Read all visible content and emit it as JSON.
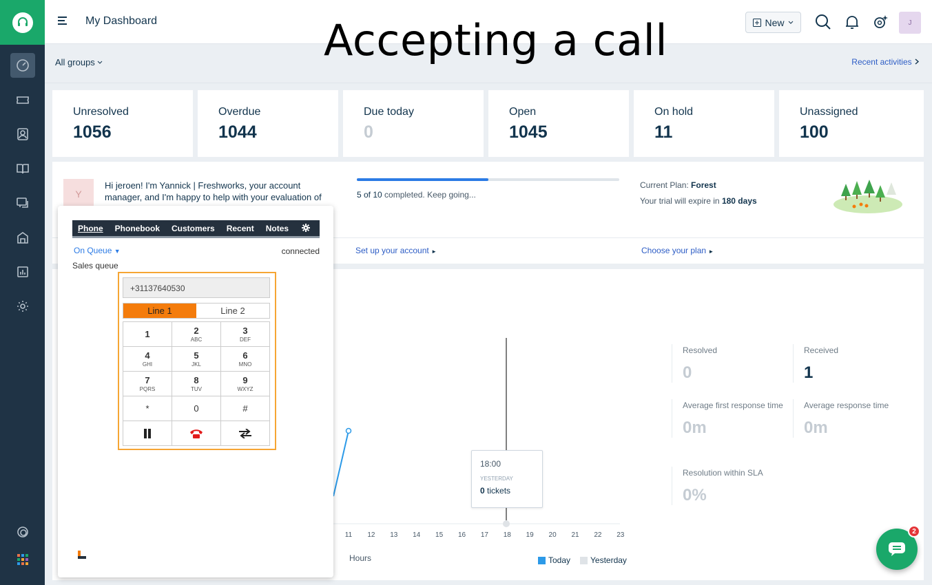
{
  "header": {
    "title": "My Dashboard",
    "overlay_caption": "Accepting a call",
    "new_label": "New",
    "avatar_initial": "J"
  },
  "subheader": {
    "groups_label": "All groups",
    "recent_label": "Recent activities"
  },
  "stats": [
    {
      "label": "Unresolved",
      "value": "1056"
    },
    {
      "label": "Overdue",
      "value": "1044"
    },
    {
      "label": "Due today",
      "value": "0"
    },
    {
      "label": "Open",
      "value": "1045"
    },
    {
      "label": "On hold",
      "value": "11"
    },
    {
      "label": "Unassigned",
      "value": "100"
    }
  ],
  "onboarding": {
    "avatar_initial": "Y",
    "message": "Hi jeroen! I'm Yannick | Freshworks, your account manager, and I'm happy to help with your evaluation of",
    "progress_done": "5 of 10",
    "progress_suffix": "completed. Keep going...",
    "progress_fraction": 0.5,
    "plan_label": "Current Plan:",
    "plan_value": "Forest",
    "trial_prefix": "Your trial will expire in",
    "trial_days": "180 days",
    "setup_link": "Set up your account",
    "plan_link": "Choose your plan"
  },
  "metrics": {
    "resolved_label": "Resolved",
    "resolved_value": "0",
    "received_label": "Received",
    "received_value": "1",
    "afr_label": "Average first response time",
    "afr_value": "0m",
    "art_label": "Average response time",
    "art_value": "0m",
    "sla_label": "Resolution within SLA",
    "sla_value": "0%"
  },
  "chart": {
    "x_ticks": [
      "11",
      "12",
      "13",
      "14",
      "15",
      "16",
      "17",
      "18",
      "19",
      "20",
      "21",
      "22",
      "23"
    ],
    "x_label": "Hours",
    "legend_today": "Today",
    "legend_yesterday": "Yesterday",
    "tooltip_time": "18:00",
    "tooltip_series": "YESTERDAY",
    "tooltip_count": "0",
    "tooltip_unit": "tickets",
    "today_color": "#2c9ae8",
    "yesterday_color": "#dfe3e7"
  },
  "phone": {
    "tabs": [
      "Phone",
      "Phonebook",
      "Customers",
      "Recent",
      "Notes"
    ],
    "queue_label": "On Queue",
    "status": "connected",
    "queue_name": "Sales queue",
    "number": "+31137640530",
    "line1": "Line 1",
    "line2": "Line 2",
    "keys": [
      {
        "main": "1",
        "sub": ""
      },
      {
        "main": "2",
        "sub": "ABC"
      },
      {
        "main": "3",
        "sub": "DEF"
      },
      {
        "main": "4",
        "sub": "GHI"
      },
      {
        "main": "5",
        "sub": "JKL"
      },
      {
        "main": "6",
        "sub": "MNO"
      },
      {
        "main": "7",
        "sub": "PQRS"
      },
      {
        "main": "8",
        "sub": "TUV"
      },
      {
        "main": "9",
        "sub": "WXYZ"
      },
      {
        "main": "*",
        "sub": ""
      },
      {
        "main": "0",
        "sub": ""
      },
      {
        "main": "#",
        "sub": ""
      }
    ]
  },
  "chat": {
    "badge_count": "2"
  },
  "colors": {
    "sidebar": "#1f3345",
    "brand_green": "#1aa86a",
    "accent_orange": "#f47c0c",
    "link_blue": "#2c5cc5"
  }
}
